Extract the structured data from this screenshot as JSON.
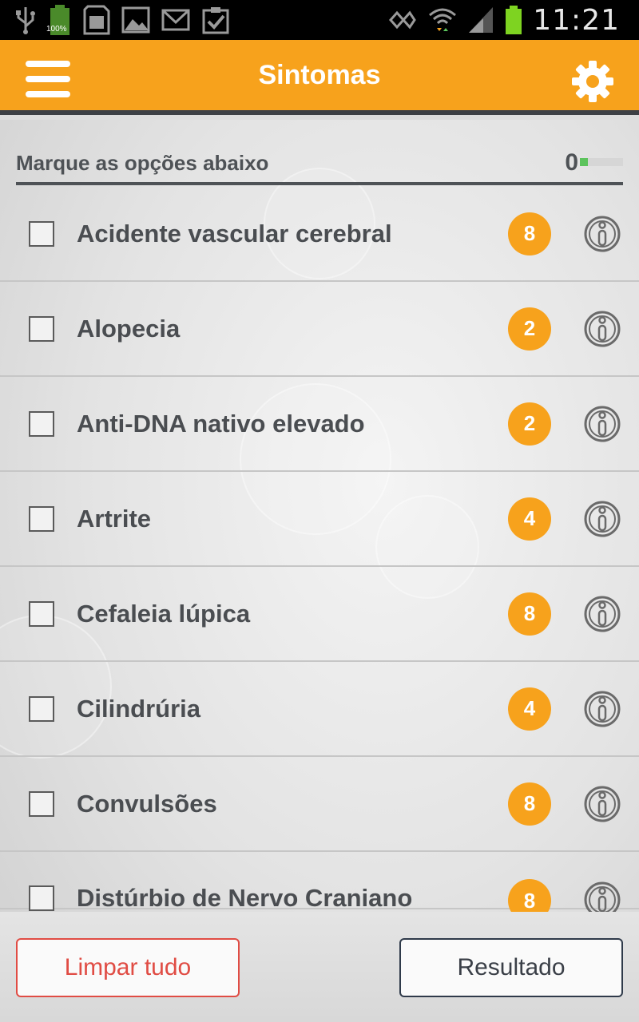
{
  "status_bar": {
    "time": "11:21",
    "battery_label": "100%",
    "icons": [
      "usb-icon",
      "battery-full-icon",
      "sd-card-icon",
      "gallery-icon",
      "gmail-icon",
      "clipboard-check-icon",
      "nfc-icon",
      "wifi-icon",
      "signal-icon",
      "battery-icon"
    ]
  },
  "header": {
    "title": "Sintomas",
    "menu_icon": "hamburger-menu-icon",
    "settings_icon": "gear-icon"
  },
  "subheader": {
    "instruction": "Marque as opções abaixo",
    "selected_count": "0"
  },
  "symptoms": [
    {
      "label": "Acidente vascular cerebral",
      "score": "8"
    },
    {
      "label": "Alopecia",
      "score": "2"
    },
    {
      "label": "Anti-DNA nativo elevado",
      "score": "2"
    },
    {
      "label": "Artrite",
      "score": "4"
    },
    {
      "label": "Cefaleia lúpica",
      "score": "8"
    },
    {
      "label": "Cilindrúria",
      "score": "4"
    },
    {
      "label": "Convulsões",
      "score": "8"
    },
    {
      "label": "Distúrbio de Nervo Craniano",
      "score": "8"
    }
  ],
  "footer": {
    "clear_label": "Limpar tudo",
    "result_label": "Resultado"
  },
  "colors": {
    "accent": "#f7a21c",
    "text": "#4a4d51",
    "danger": "#e04c44",
    "dark": "#2f3a4a"
  }
}
